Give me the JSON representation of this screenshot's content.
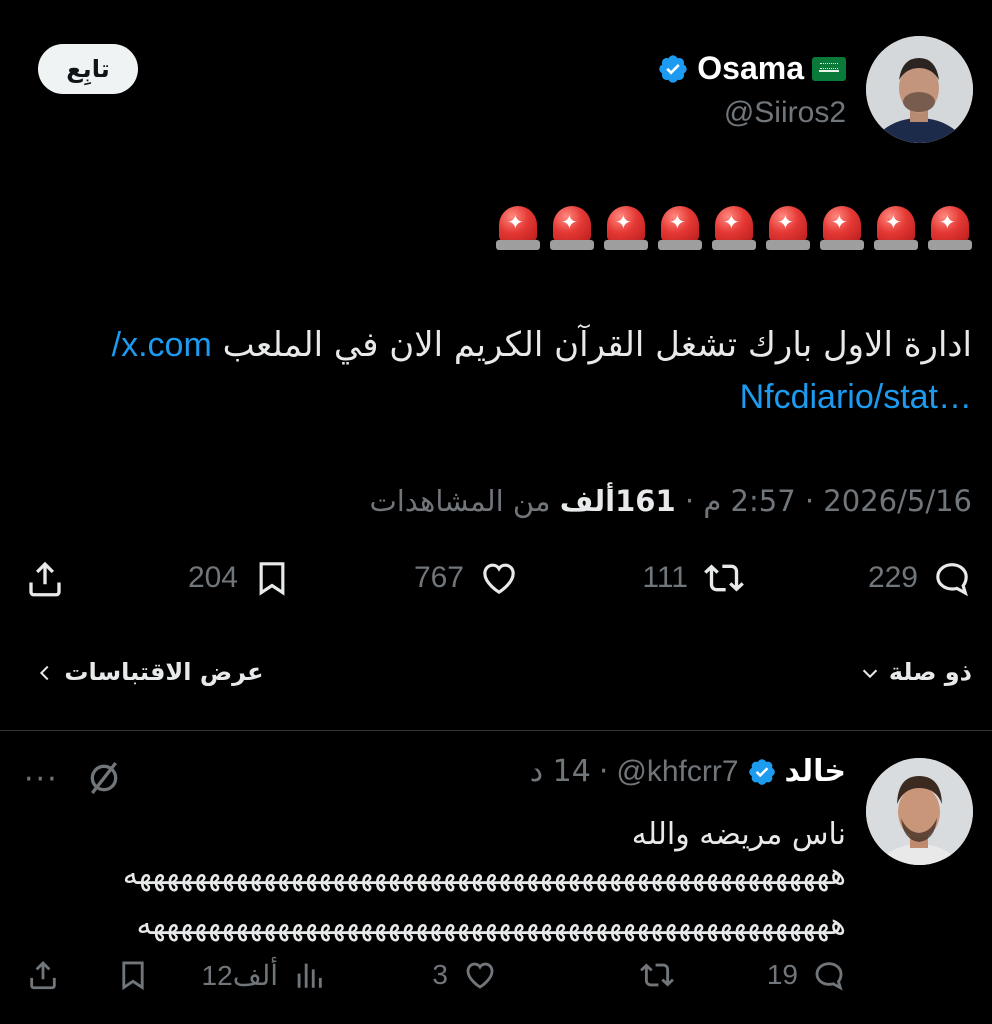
{
  "tweet": {
    "author": {
      "display_name": "Osama",
      "handle": "@Siiros2",
      "verified_icon": "verified-badge-icon",
      "flag_icon": "saudi-flag-icon"
    },
    "follow_label": "تابِع",
    "alarm_emoji_count": 9,
    "text": "ادارة الاول بارك تشغل القرآن الكريم الان في الملعب ",
    "link_part1": "x.com/",
    "link_part2": "Nfcdiario/stat…",
    "meta": {
      "date": "2026/5/16",
      "time": "2:57 م",
      "views_count": "161",
      "views_unit": "ألف",
      "views_label": " من المشاهدات"
    },
    "actions": {
      "replies": "229",
      "retweets": "111",
      "likes": "767",
      "bookmarks": "204"
    },
    "conversation_toggle": "ذو صلة",
    "quotes_link": "عرض الاقتباسات"
  },
  "reply": {
    "display_name": "خالد",
    "handle": "@khfcrr7",
    "time": "14 د",
    "text": "ناس مريضه والله",
    "laugh_line1": "هههههههههههههههههههههههههههههههههههههههههههههههههههه",
    "laugh_line2": "ههههههههههههههههههههههههههههههههههههههههههههههههههه",
    "more": "···",
    "actions": {
      "replies": "19",
      "retweets": "",
      "likes": "3",
      "views": "12ألف",
      "bookmarks": ""
    }
  }
}
